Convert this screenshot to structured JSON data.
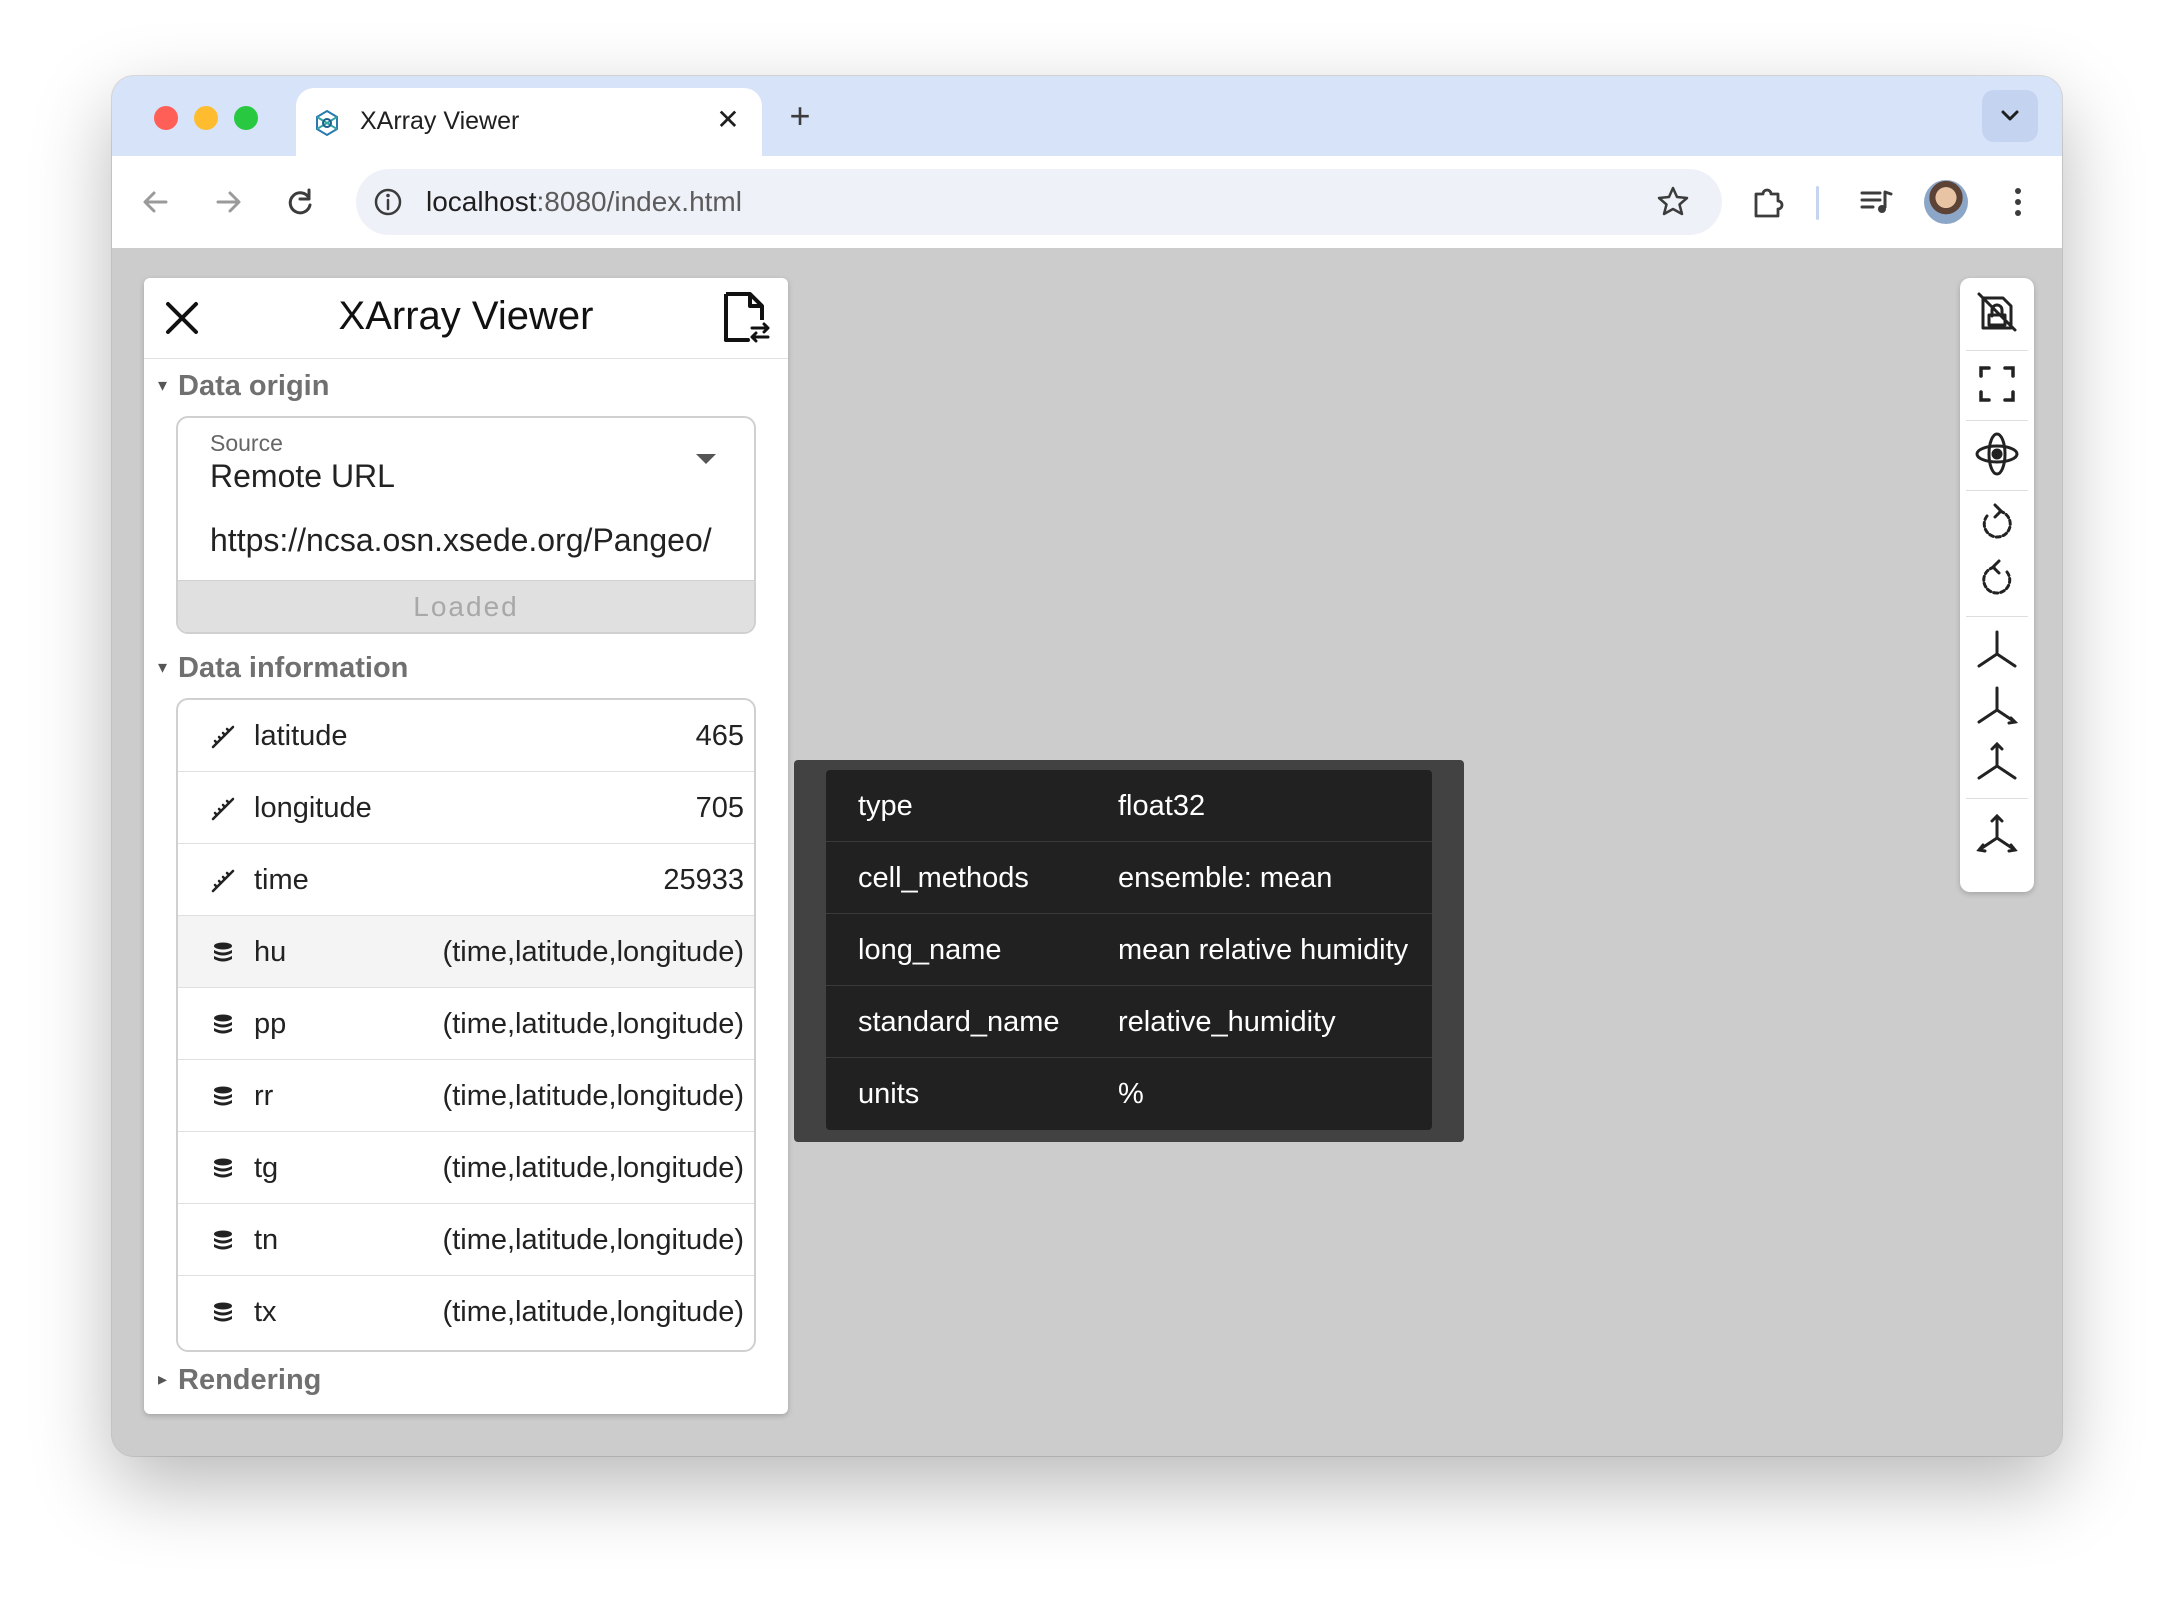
{
  "browser": {
    "tab_title": "XArray Viewer",
    "url_host": "localhost",
    "url_path": ":8080/index.html"
  },
  "panel": {
    "title": "XArray Viewer",
    "data_origin": {
      "heading": "Data origin",
      "source_label": "Source",
      "source_value": "Remote URL",
      "url_value": "https://ncsa.osn.xsede.org/Pangeo/",
      "loaded_label": "Loaded"
    },
    "data_information": {
      "heading": "Data information",
      "rows": [
        {
          "icon": "ruler-icon",
          "name": "latitude",
          "value": "465"
        },
        {
          "icon": "ruler-icon",
          "name": "longitude",
          "value": "705"
        },
        {
          "icon": "ruler-icon",
          "name": "time",
          "value": "25933"
        },
        {
          "icon": "database-icon",
          "name": "hu",
          "value": "(time,latitude,longitude)"
        },
        {
          "icon": "database-icon",
          "name": "pp",
          "value": "(time,latitude,longitude)"
        },
        {
          "icon": "database-icon",
          "name": "rr",
          "value": "(time,latitude,longitude)"
        },
        {
          "icon": "database-icon",
          "name": "tg",
          "value": "(time,latitude,longitude)"
        },
        {
          "icon": "database-icon",
          "name": "tn",
          "value": "(time,latitude,longitude)"
        },
        {
          "icon": "database-icon",
          "name": "tx",
          "value": "(time,latitude,longitude)"
        }
      ]
    },
    "rendering": {
      "heading": "Rendering"
    }
  },
  "tooltip": {
    "rows": [
      {
        "key": "type",
        "value": "float32"
      },
      {
        "key": "cell_methods",
        "value": "ensemble: mean"
      },
      {
        "key": "long_name",
        "value": "mean relative humidity"
      },
      {
        "key": "standard_name",
        "value": "relative_humidity"
      },
      {
        "key": "units",
        "value": "%"
      }
    ]
  },
  "right_toolbar": {
    "icons": [
      "lock-off-icon",
      "fullscreen-icon",
      "orbit-icon",
      "rotate-left-icon",
      "rotate-right-icon",
      "axis-x-icon",
      "axis-y-icon",
      "axis-z-icon",
      "axis-iso-icon"
    ]
  },
  "colors": {
    "tab_bar": "#d7e3f8",
    "viewport": "#cccccc",
    "tooltip_bg": "#212121",
    "highlight_row": "#f4f4f4"
  }
}
